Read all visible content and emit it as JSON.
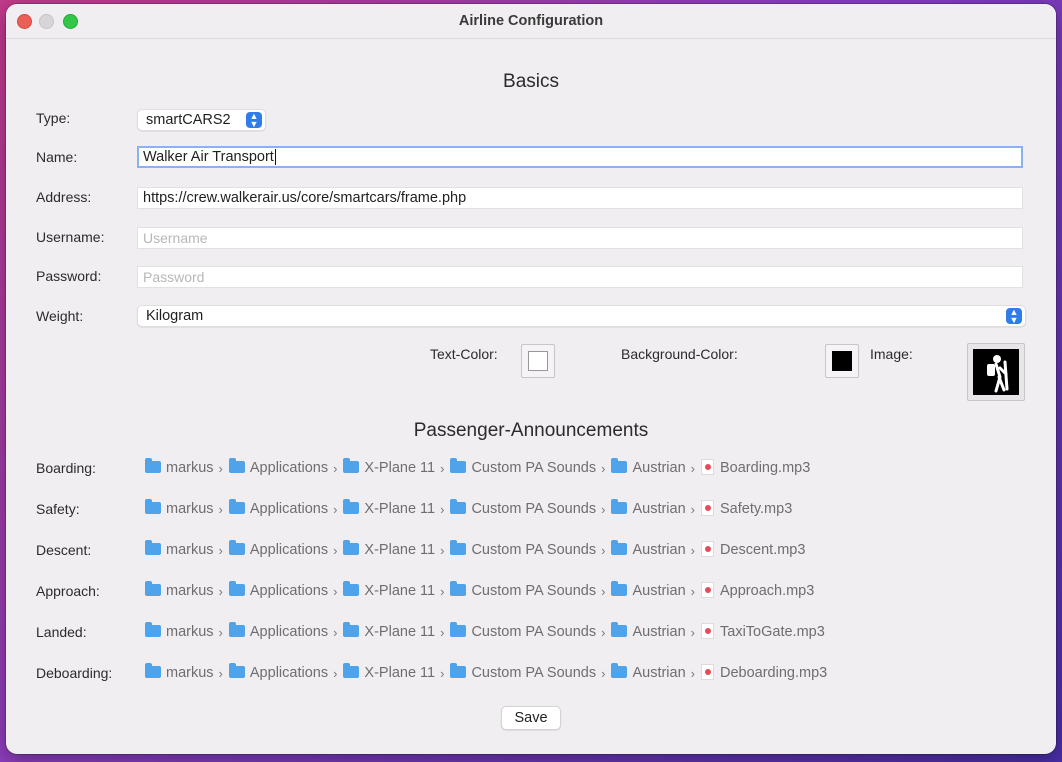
{
  "window": {
    "title": "Airline Configuration"
  },
  "basics": {
    "heading": "Basics",
    "type": {
      "label": "Type:",
      "value": "smartCARS2"
    },
    "name": {
      "label": "Name:",
      "value": "Walker Air Transport"
    },
    "address": {
      "label": "Address:",
      "value": "https://crew.walkerair.us/core/smartcars/frame.php"
    },
    "username": {
      "label": "Username:",
      "value": "",
      "placeholder": "Username"
    },
    "password": {
      "label": "Password:",
      "value": "",
      "placeholder": "Password"
    },
    "weight": {
      "label": "Weight:",
      "value": "Kilogram"
    },
    "text_color": {
      "label": "Text-Color:",
      "color": "#ffffff"
    },
    "background_color": {
      "label": "Background-Color:",
      "color": "#000000"
    },
    "image": {
      "label": "Image:"
    }
  },
  "announcements": {
    "heading": "Passenger-Announcements",
    "path_segments": [
      "markus",
      "Applications",
      "X-Plane 11",
      "Custom PA Sounds",
      "Austrian"
    ],
    "rows": [
      {
        "label": "Boarding:",
        "file": "Boarding.mp3"
      },
      {
        "label": "Safety:",
        "file": "Safety.mp3"
      },
      {
        "label": "Descent:",
        "file": "Descent.mp3"
      },
      {
        "label": "Approach:",
        "file": "Approach.mp3"
      },
      {
        "label": "Landed:",
        "file": "TaxiToGate.mp3"
      },
      {
        "label": "Deboarding:",
        "file": "Deboarding.mp3"
      }
    ]
  },
  "actions": {
    "save_label": "Save"
  },
  "colors": {
    "accent": "#2f7de9",
    "focus_ring": "#8bb2f0",
    "folder": "#4fa3ea"
  }
}
